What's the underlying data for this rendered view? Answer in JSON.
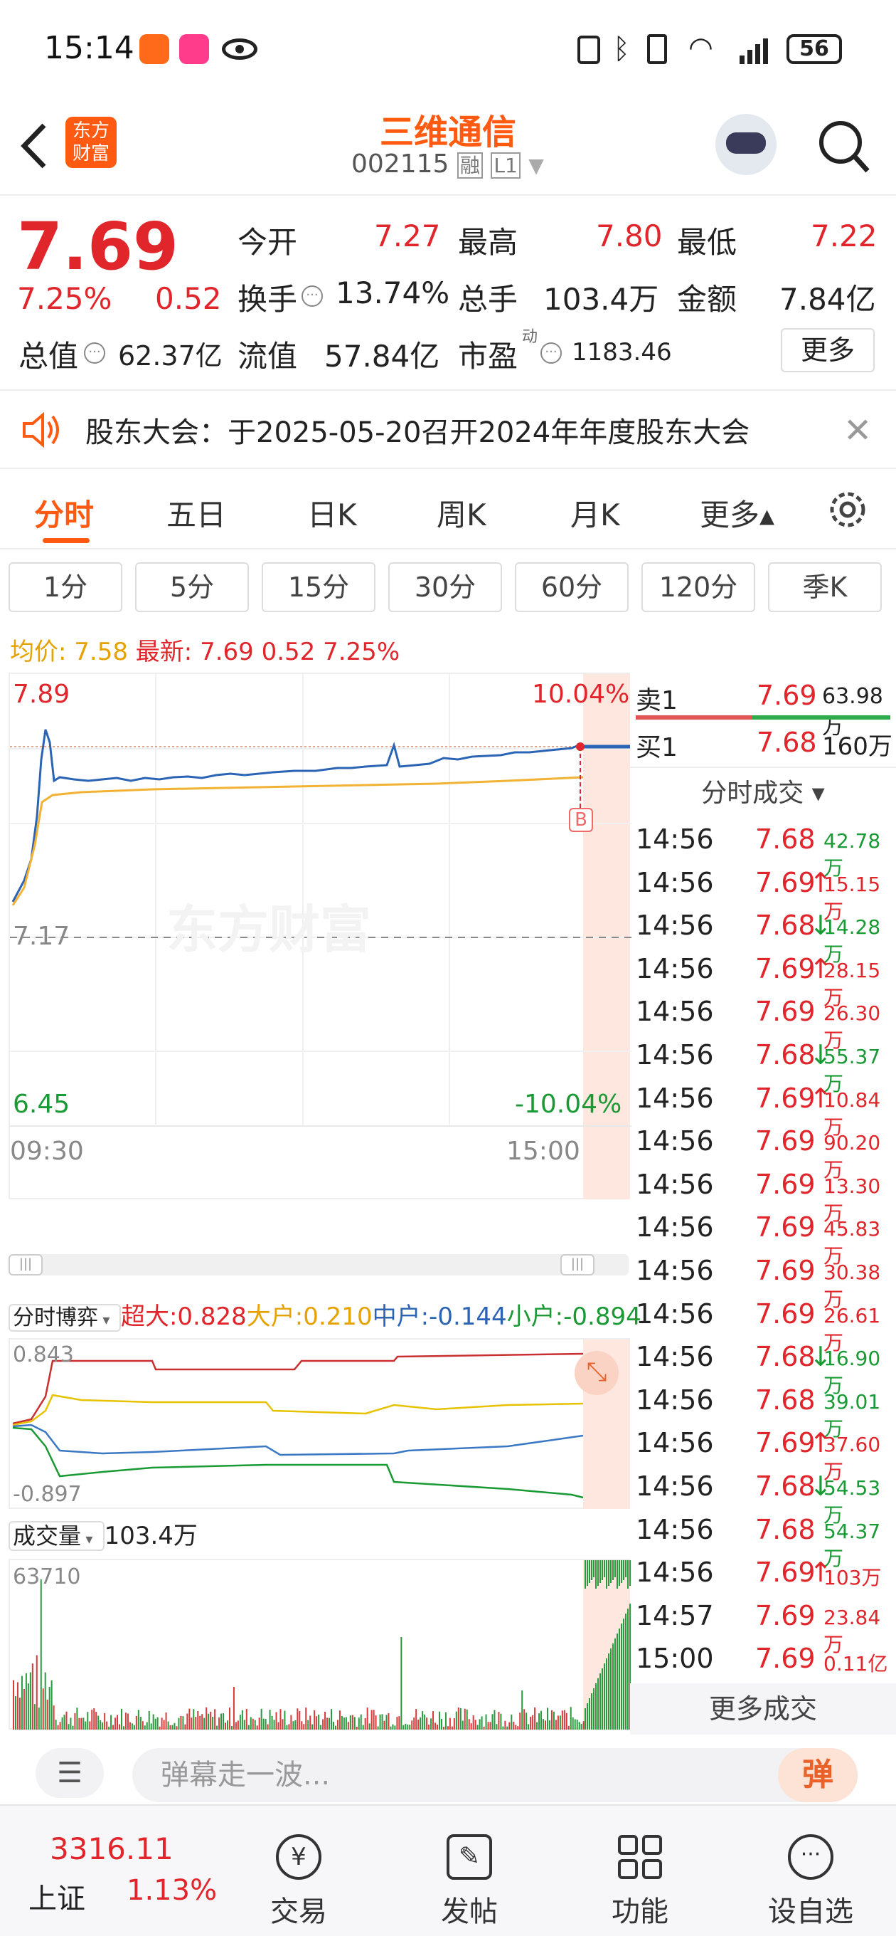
{
  "status": {
    "time": "15:14",
    "battery": "56"
  },
  "header": {
    "title": "三维通信",
    "code": "002115",
    "tag1": "融",
    "tag2": "L1",
    "logo_line1": "东方",
    "logo_line2": "财富"
  },
  "quote": {
    "price": "7.69",
    "change_pct": "7.25%",
    "change": "0.52",
    "open_label": "今开",
    "open": "7.27",
    "high_label": "最高",
    "high": "7.80",
    "low_label": "最低",
    "low": "7.22",
    "turnover_label": "换手",
    "turnover": "13.74%",
    "vol_label": "总手",
    "vol": "103.4万",
    "amount_label": "金额",
    "amount": "7.84亿",
    "mcap_label": "总值",
    "mcap": "62.37亿",
    "float_label": "流值",
    "float": "57.84亿",
    "pe_label": "市盈",
    "pe_sup": "动",
    "pe": "1183.46",
    "more": "更多"
  },
  "notice": {
    "text": "股东大会：于2025-05-20召开2024年年度股东大会"
  },
  "tabs": [
    "分时",
    "五日",
    "日K",
    "周K",
    "月K",
    "更多▴"
  ],
  "periods": [
    "1分",
    "5分",
    "15分",
    "30分",
    "60分",
    "120分",
    "季K"
  ],
  "summary": {
    "avg_label": "均价:",
    "avg": "7.58",
    "last_label": "最新:",
    "last": "7.69",
    "chg": "0.52",
    "pct": "7.25%"
  },
  "chart": {
    "top_price": "7.89",
    "top_pct": "10.04%",
    "mid_price": "7.17",
    "bot_price": "6.45",
    "bot_pct": "-10.04%",
    "t_start": "09:30",
    "t_end": "15:00",
    "watermark": "东方财富",
    "marker": "B"
  },
  "flow": {
    "selector": "分时博弈",
    "super_label": "超大:",
    "super": "0.828",
    "big_label": "大户:",
    "big": "0.210",
    "mid_label": "中户:",
    "mid": "-0.144",
    "small_label": "小户:",
    "small": "-0.894",
    "max": "0.843",
    "min": "-0.897"
  },
  "volume": {
    "selector": "成交量",
    "total": "103.4万",
    "max": "63710"
  },
  "orderbook": {
    "sell_label": "卖1",
    "sell_price": "7.69",
    "sell_vol": "63.98万",
    "buy_label": "买1",
    "buy_price": "7.68",
    "buy_vol": "160万"
  },
  "trades_header": "分时成交 ▾",
  "trades": [
    {
      "t": "14:56",
      "p": "7.68",
      "a": "",
      "v": "42.78万",
      "c": "g",
      "pc": "r"
    },
    {
      "t": "14:56",
      "p": "7.69",
      "a": "↑",
      "v": "15.15万",
      "c": "r",
      "pc": "r"
    },
    {
      "t": "14:56",
      "p": "7.68",
      "a": "↓",
      "v": "14.28万",
      "c": "g",
      "pc": "r"
    },
    {
      "t": "14:56",
      "p": "7.69",
      "a": "↑",
      "v": "28.15万",
      "c": "r",
      "pc": "r"
    },
    {
      "t": "14:56",
      "p": "7.69",
      "a": "",
      "v": "26.30万",
      "c": "r",
      "pc": "r"
    },
    {
      "t": "14:56",
      "p": "7.68",
      "a": "↓",
      "v": "55.37万",
      "c": "g",
      "pc": "r"
    },
    {
      "t": "14:56",
      "p": "7.69",
      "a": "↑",
      "v": "10.84万",
      "c": "r",
      "pc": "r"
    },
    {
      "t": "14:56",
      "p": "7.69",
      "a": "",
      "v": "90.20万",
      "c": "r",
      "pc": "r"
    },
    {
      "t": "14:56",
      "p": "7.69",
      "a": "",
      "v": "13.30万",
      "c": "r",
      "pc": "r"
    },
    {
      "t": "14:56",
      "p": "7.69",
      "a": "",
      "v": "45.83万",
      "c": "r",
      "pc": "r"
    },
    {
      "t": "14:56",
      "p": "7.69",
      "a": "",
      "v": "30.38万",
      "c": "r",
      "pc": "r"
    },
    {
      "t": "14:56",
      "p": "7.69",
      "a": "",
      "v": "26.61万",
      "c": "r",
      "pc": "r"
    },
    {
      "t": "14:56",
      "p": "7.68",
      "a": "↓",
      "v": "16.90万",
      "c": "g",
      "pc": "r"
    },
    {
      "t": "14:56",
      "p": "7.68",
      "a": "",
      "v": "39.01万",
      "c": "g",
      "pc": "r"
    },
    {
      "t": "14:56",
      "p": "7.69",
      "a": "↑",
      "v": "37.60万",
      "c": "r",
      "pc": "r"
    },
    {
      "t": "14:56",
      "p": "7.68",
      "a": "↓",
      "v": "54.53万",
      "c": "g",
      "pc": "r"
    },
    {
      "t": "14:56",
      "p": "7.68",
      "a": "",
      "v": "54.37万",
      "c": "g",
      "pc": "r"
    },
    {
      "t": "14:56",
      "p": "7.69",
      "a": "↑",
      "v": "103万",
      "c": "r",
      "pc": "r"
    },
    {
      "t": "14:57",
      "p": "7.69",
      "a": "",
      "v": "23.84万",
      "c": "r",
      "pc": "r"
    },
    {
      "t": "15:00",
      "p": "7.69",
      "a": "",
      "v": "0.11亿",
      "c": "r",
      "pc": "r"
    }
  ],
  "more_trades": "更多成交",
  "danmu": {
    "placeholder": "弹幕走一波...",
    "btn": "弹"
  },
  "bottom": {
    "index_value": "3316.11",
    "index_name": "上证",
    "index_pct": "1.13%",
    "nav": [
      "交易",
      "发帖",
      "功能",
      "设自选"
    ]
  }
}
